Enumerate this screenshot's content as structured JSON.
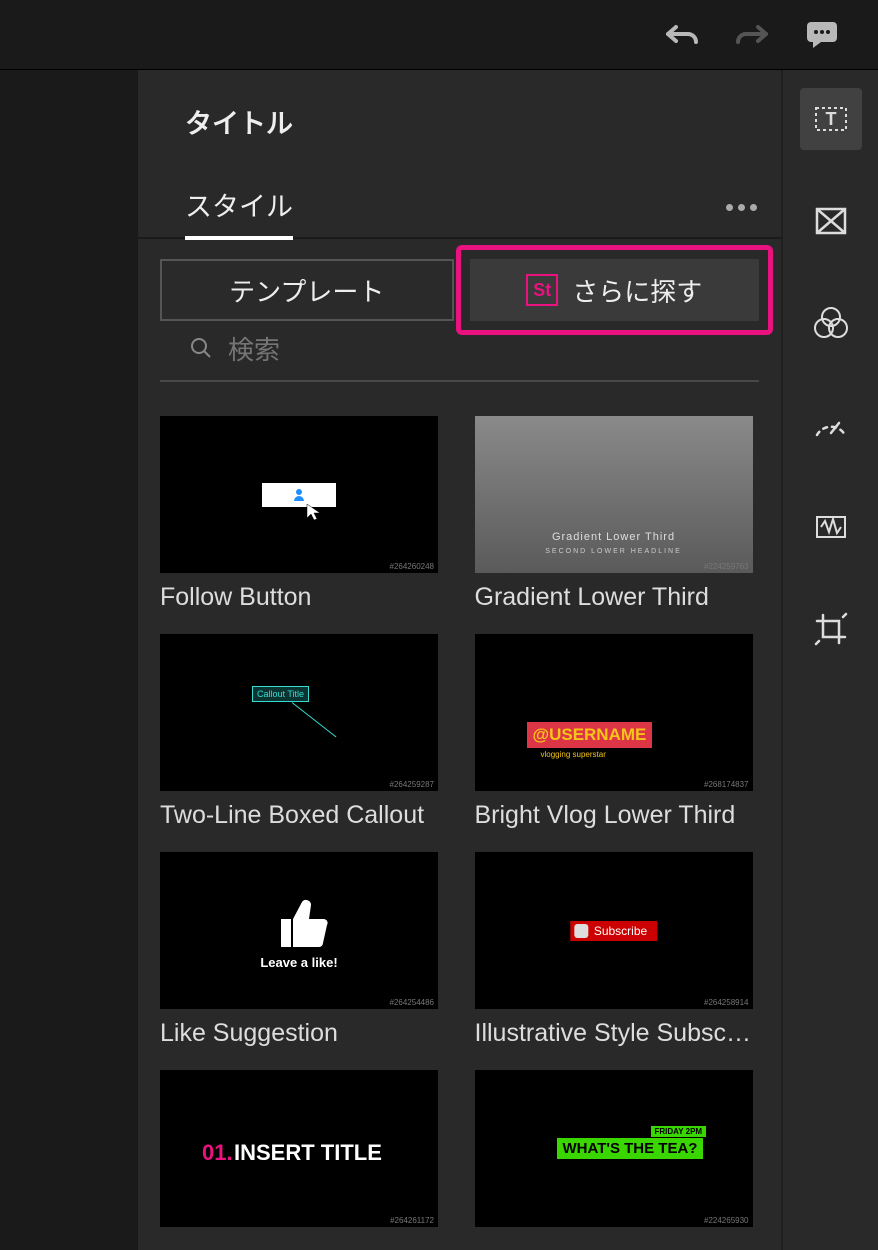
{
  "topbar": {
    "undo": "undo",
    "redo": "redo",
    "comment": "comment"
  },
  "panel": {
    "title": "タイトル",
    "tab": "スタイル",
    "templates_label": "テンプレート",
    "stock_label": "さらに探す",
    "stock_badge": "St",
    "search_placeholder": "検索"
  },
  "rail_items": [
    "text",
    "transition",
    "color",
    "speed",
    "audio",
    "crop"
  ],
  "templates": [
    {
      "label": "Follow Button",
      "id": "#264260248",
      "t1": {
        "cursor": true
      }
    },
    {
      "label": "Gradient Lower Third",
      "id": "#224259763",
      "t2": {
        "line1": "Gradient Lower Third",
        "line2": "SECOND LOWER HEADLINE"
      }
    },
    {
      "label": "Two-Line Boxed Callout",
      "id": "#264259287",
      "t3": {
        "box": "Callout Title"
      }
    },
    {
      "label": "Bright Vlog Lower Third",
      "id": "#268174837",
      "t4": {
        "user": "@USERNAME",
        "sub": "vlogging superstar"
      }
    },
    {
      "label": "Like Suggestion",
      "id": "#264254486",
      "t5": {
        "txt": "Leave a like!"
      }
    },
    {
      "label": "Illustrative Style Subscribe",
      "id": "#264258914",
      "t6": {
        "txt": "Subscribe"
      }
    },
    {
      "label": "",
      "id": "#264261172",
      "t7": {
        "num": "01.",
        "txt": "INSERT TITLE"
      }
    },
    {
      "label": "",
      "id": "#224265930",
      "t8": {
        "tag": "FRIDAY 2PM",
        "txt": "WHAT'S THE TEA?"
      }
    }
  ]
}
